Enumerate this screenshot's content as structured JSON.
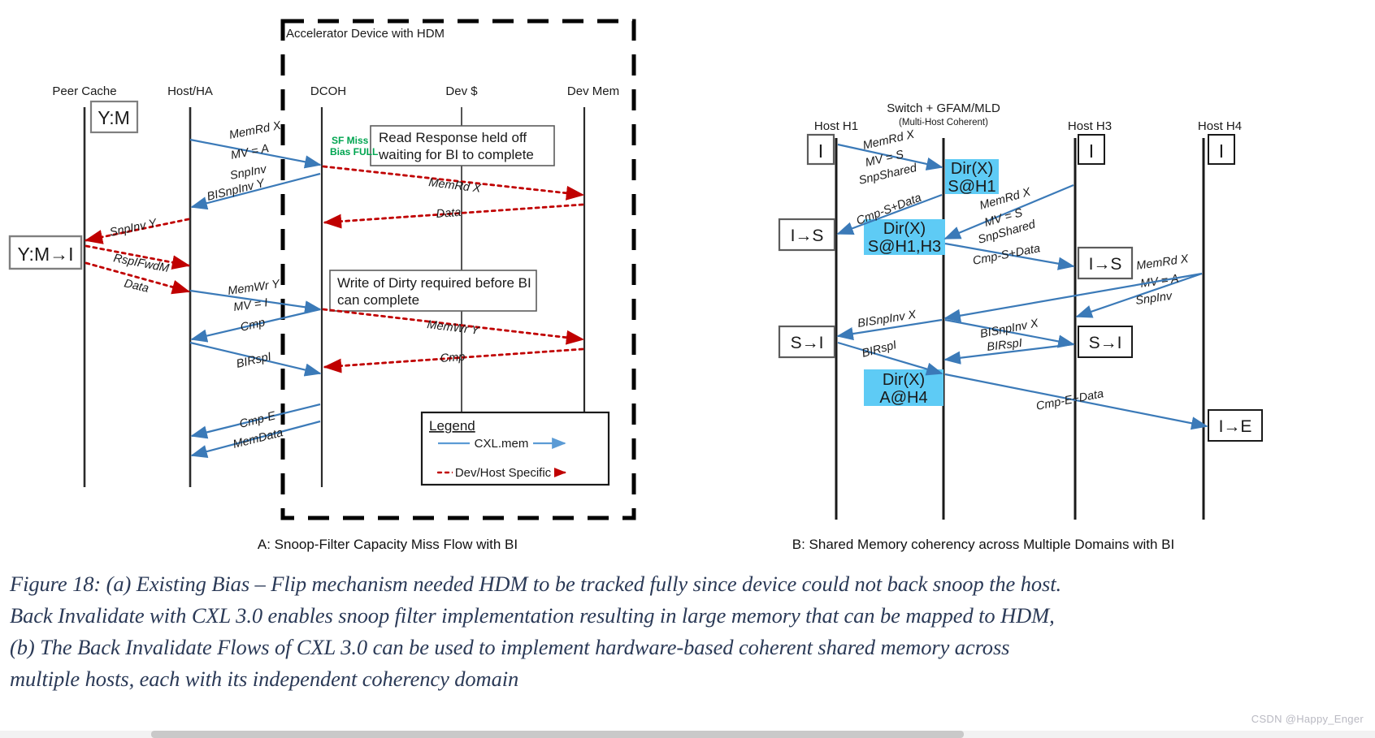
{
  "panelA": {
    "caption": "A: Snoop-Filter Capacity Miss Flow with BI",
    "device_box_label": "Accelerator Device with HDM",
    "lifelines": [
      {
        "name": "Peer Cache"
      },
      {
        "name": "Host/HA"
      },
      {
        "name": "DCOH"
      },
      {
        "name": "Dev $"
      },
      {
        "name": "Dev Mem"
      }
    ],
    "state_boxes": [
      {
        "text": "Y:M"
      },
      {
        "text": "Y:M→I"
      }
    ],
    "annotations": {
      "sf_miss": "SF Miss",
      "bias_full": "Bias FULL"
    },
    "notes": [
      {
        "line1": "Read Response held off",
        "line2": "waiting for BI to complete"
      },
      {
        "line1": "Write of Dirty required before BI",
        "line2": "can complete"
      }
    ],
    "messages": [
      {
        "text": "MemRd X"
      },
      {
        "text": "MV = A"
      },
      {
        "text": "SnpInv"
      },
      {
        "text": "BISnpInv Y"
      },
      {
        "text": "SnpInv Y"
      },
      {
        "text": "RspIFwdM"
      },
      {
        "text": "Data"
      },
      {
        "text": "MemRd X"
      },
      {
        "text": "Data"
      },
      {
        "text": "MemWr Y"
      },
      {
        "text": "MV = I"
      },
      {
        "text": "Cmp"
      },
      {
        "text": "MemWr Y"
      },
      {
        "text": "Cmp"
      },
      {
        "text": "BIRspI"
      },
      {
        "text": "Cmp-E"
      },
      {
        "text": "MemData"
      }
    ],
    "legend": {
      "title": "Legend",
      "items": [
        {
          "label": "CXL.mem",
          "color": "#4a86c8",
          "style": "solid"
        },
        {
          "label": "Dev/Host Specific",
          "color": "#c00000",
          "style": "dotted"
        }
      ]
    }
  },
  "panelB": {
    "caption": "B: Shared Memory coherency across Multiple Domains with BI",
    "switch_title": "Switch + GFAM/MLD",
    "switch_subtitle": "(Multi-Host Coherent)",
    "lifelines": [
      {
        "name": "Host H1"
      },
      {
        "name": "Host H3"
      },
      {
        "name": "Host H4"
      }
    ],
    "state_boxes": [
      {
        "text": "I"
      },
      {
        "text": "I→S"
      },
      {
        "text": "S→I"
      },
      {
        "text": "I"
      },
      {
        "text": "I→S"
      },
      {
        "text": "S→I"
      },
      {
        "text": "I"
      },
      {
        "text": "I→E"
      }
    ],
    "dir_boxes": [
      {
        "line1": "Dir(X)",
        "line2": "S@H1"
      },
      {
        "line1": "Dir(X)",
        "line2": "S@H1,H3"
      },
      {
        "line1": "Dir(X)",
        "line2": "A@H4"
      }
    ],
    "messages": [
      {
        "text": "MemRd X"
      },
      {
        "text": "MV = S"
      },
      {
        "text": "SnpShared"
      },
      {
        "text": "Cmp-S+Data"
      },
      {
        "text": "MemRd X"
      },
      {
        "text": "MV = S"
      },
      {
        "text": "SnpShared"
      },
      {
        "text": "Cmp-S+Data"
      },
      {
        "text": "MemRd X"
      },
      {
        "text": "MV = A"
      },
      {
        "text": "SnpInv"
      },
      {
        "text": "BISnpInv X"
      },
      {
        "text": "BISnpInv X"
      },
      {
        "text": "BIRspI"
      },
      {
        "text": "BIRspI"
      },
      {
        "text": "Cmp-E+Data"
      }
    ],
    "dir_box_color": "#5ecbf5"
  },
  "figure_caption": {
    "line1": "Figure 18: (a) Existing Bias – Flip mechanism needed HDM to be tracked fully since device could not back snoop the host.",
    "line2": "Back Invalidate with CXL 3.0 enables snoop filter implementation resulting in large memory that can be mapped to HDM,",
    "line3": "(b) The Back Invalidate Flows of CXL 3.0 can be used to implement hardware-based coherent shared memory across",
    "line4": "multiple hosts, each with its independent coherency domain"
  },
  "watermark": "CSDN @Happy_Enger",
  "colors": {
    "cxl_mem_blue": "#4a86c8",
    "dev_host_red": "#c00000",
    "dir_highlight": "#5ecbf5",
    "sf_miss_green": "#00a550",
    "lifeline": "#2b2b2b"
  }
}
